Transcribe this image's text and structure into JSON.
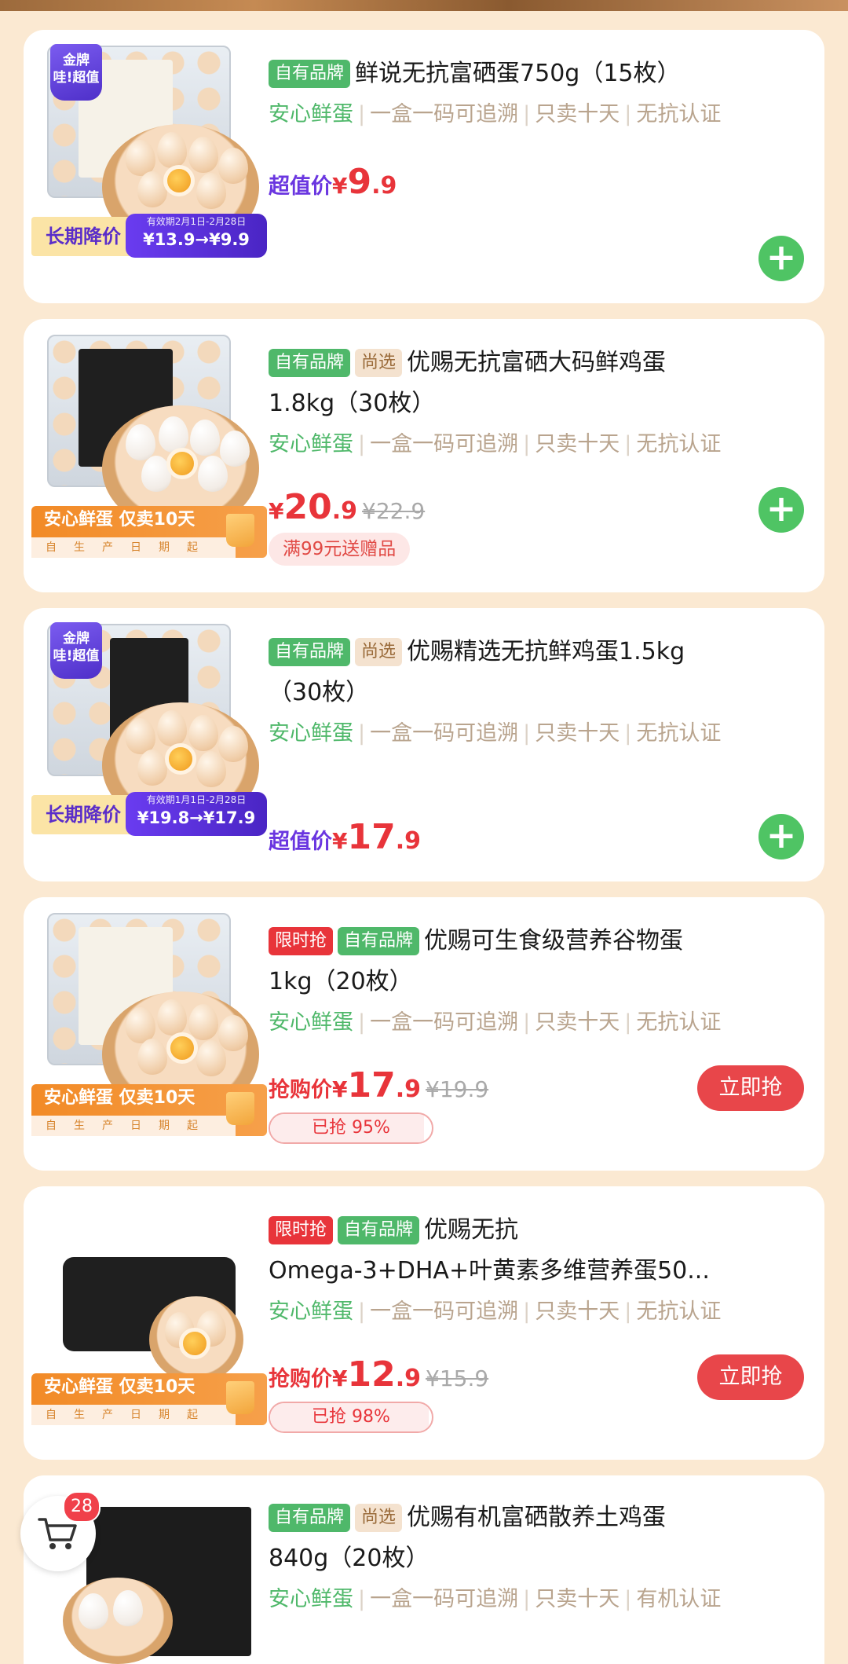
{
  "products": [
    {
      "tags": [
        "自有品牌"
      ],
      "title": "鲜说无抗富硒蛋750g（15枚）",
      "features": [
        "安心鲜蛋",
        "一盒一码可追溯",
        "只卖十天",
        "无抗认证"
      ],
      "badge": "金牌\n哇!超值",
      "promo_label": "长期降价",
      "promo_valid": "有效期2月1日-2月28日",
      "promo_trend": "¥13.9→¥9.9",
      "price_label": "超值价",
      "price_cur": "¥",
      "price_int": "9",
      "price_dec": ".9",
      "action": "+"
    },
    {
      "tags": [
        "自有品牌",
        "尚选"
      ],
      "title": "优赐无抗富硒大码鲜鸡蛋",
      "title2": "1.8kg（30枚）",
      "features": [
        "安心鲜蛋",
        "一盒一码可追溯",
        "只卖十天",
        "无抗认证"
      ],
      "promo_main": "安心鲜蛋 仅卖10天",
      "promo_sub": "自生产日期起",
      "price_cur": "¥",
      "price_int": "20",
      "price_dec": ".9",
      "orig_price": "¥22.9",
      "gift": "满99元送赠品",
      "action": "+"
    },
    {
      "tags": [
        "自有品牌",
        "尚选"
      ],
      "title": "优赐精选无抗鲜鸡蛋1.5kg",
      "title2": "（30枚）",
      "features": [
        "安心鲜蛋",
        "一盒一码可追溯",
        "只卖十天",
        "无抗认证"
      ],
      "badge": "金牌\n哇!超值",
      "promo_label": "长期降价",
      "promo_valid": "有效期1月1日-2月28日",
      "promo_trend": "¥19.8→¥17.9",
      "price_label": "超值价",
      "price_cur": "¥",
      "price_int": "17",
      "price_dec": ".9",
      "action": "+"
    },
    {
      "tags": [
        "限时抢",
        "自有品牌"
      ],
      "title": "优赐可生食级营养谷物蛋",
      "title2": "1kg（20枚）",
      "features": [
        "安心鲜蛋",
        "一盒一码可追溯",
        "只卖十天",
        "无抗认证"
      ],
      "promo_main": "安心鲜蛋 仅卖10天",
      "promo_sub": "自生产日期起",
      "price_label": "抢购价",
      "price_cur": "¥",
      "price_int": "17",
      "price_dec": ".9",
      "orig_price": "¥19.9",
      "progress_text": "已抢 95%",
      "progress": 0.95,
      "action": "立即抢"
    },
    {
      "tags": [
        "限时抢",
        "自有品牌"
      ],
      "title": "优赐无抗",
      "title2": "Omega-3+DHA+叶黄素多维营养蛋50...",
      "features": [
        "安心鲜蛋",
        "一盒一码可追溯",
        "只卖十天",
        "无抗认证"
      ],
      "promo_main": "安心鲜蛋 仅卖10天",
      "promo_sub": "自生产日期起",
      "price_label": "抢购价",
      "price_cur": "¥",
      "price_int": "12",
      "price_dec": ".9",
      "orig_price": "¥15.9",
      "progress_text": "已抢 98%",
      "progress": 0.98,
      "action": "立即抢"
    },
    {
      "tags": [
        "自有品牌",
        "尚选"
      ],
      "title": "优赐有机富硒散养土鸡蛋",
      "title2": "840g（20枚）",
      "features": [
        "安心鲜蛋",
        "一盒一码可追溯",
        "只卖十天",
        "有机认证"
      ]
    }
  ],
  "cart": {
    "count": "28"
  },
  "colors": {
    "page_bg": "#fbe9d2",
    "brand_green": "#4fb86a",
    "price_red": "#e8343a",
    "super_purple": "#6a36e0"
  }
}
